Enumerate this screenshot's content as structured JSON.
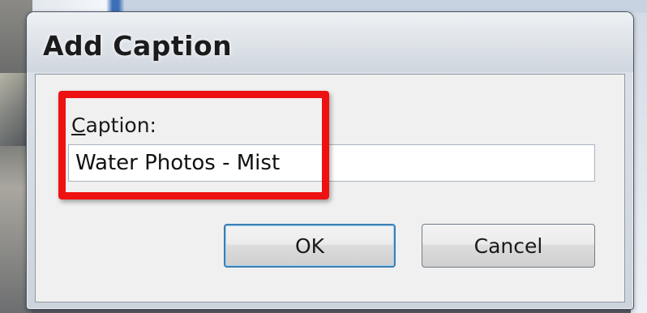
{
  "dialog": {
    "title": "Add Caption",
    "caption_label_accel": "C",
    "caption_label_rest": "aption:",
    "caption_value": "Water Photos - Mist",
    "ok_label": "OK",
    "cancel_label": "Cancel"
  },
  "annotation": {
    "highlight_color": "#ee1111"
  }
}
